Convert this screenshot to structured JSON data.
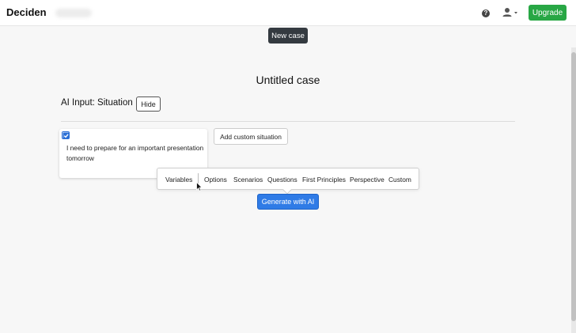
{
  "navbar": {
    "brand": "Deciden",
    "help_icon": "question-circle-icon",
    "help_glyph": "?",
    "user_icon": "user-icon",
    "upgrade_label": "Upgrade",
    "upgrade_color": "#28a745"
  },
  "toolbar": {
    "new_case_label": "New case"
  },
  "case": {
    "title": "Untitled case"
  },
  "ai_input": {
    "section_title": "AI Input: Situation",
    "hide_label": "Hide",
    "situations": [
      {
        "checked": true,
        "text": "I need to prepare for an important presentation tomorrow"
      }
    ],
    "add_situation_label": "Add custom situation"
  },
  "generate_menu": {
    "items": [
      "Variables",
      "Options",
      "Scenarios",
      "Questions",
      "First Principles",
      "Perspective",
      "Custom"
    ]
  },
  "generate_button": {
    "label": "Generate with AI",
    "color": "#2f7be6"
  }
}
